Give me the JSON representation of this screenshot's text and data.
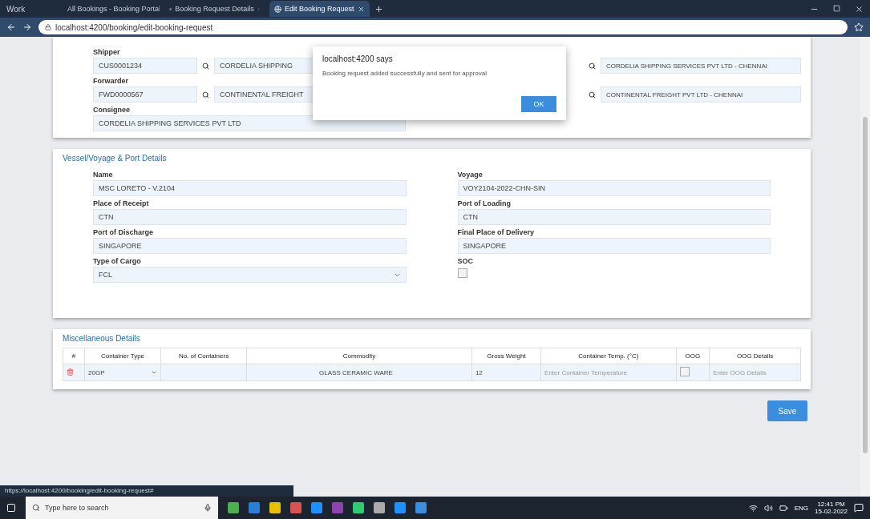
{
  "browser": {
    "profile": "Work",
    "tabs": [
      {
        "title": "All Bookings - Booking Portal",
        "selected": false
      },
      {
        "title": "Booking Request Details",
        "selected": false
      },
      {
        "title": "Edit Booking Request",
        "selected": true
      }
    ],
    "url": "localhost:4200/booking/edit-booking-request"
  },
  "parties": {
    "rows": [
      {
        "label": "Shipper",
        "code": "CUS0001234",
        "name": "CORDELIA SHIPPING",
        "name2": "CORDELIA SHIPPING SERVICES PVT LTD - CHENNAI"
      },
      {
        "label": "Forwarder",
        "code": "FWD0000567",
        "name": "CONTINENTAL FREIGHT",
        "name2": "CONTINENTAL FREIGHT PVT LTD - CHENNAI"
      }
    ],
    "consignee": {
      "label": "Consignee",
      "value": "CORDELIA SHIPPING SERVICES PVT LTD"
    }
  },
  "dialog": {
    "title": "localhost:4200 says",
    "message": "Booking request added successfully and sent for approval",
    "button": "OK"
  },
  "voyage": {
    "title": "Vessel/Voyage & Port Details",
    "fields": [
      {
        "label": "Name",
        "value": "MSC LORETO - V.2104",
        "kind": "text"
      },
      {
        "label": "Voyage",
        "value": "VOY2104-2022-CHN-SIN",
        "kind": "text"
      },
      {
        "label": "Place of Receipt",
        "value": "CTN",
        "kind": "text"
      },
      {
        "label": "Port of Loading",
        "value": "CTN",
        "kind": "text"
      },
      {
        "label": "Port of Discharge",
        "value": "SINGAPORE",
        "kind": "text"
      },
      {
        "label": "Final Place of Delivery",
        "value": "SINGAPORE",
        "kind": "text"
      },
      {
        "label": "Type of Cargo",
        "value": "FCL",
        "kind": "select"
      },
      {
        "label": "SOC",
        "checked": false,
        "kind": "checkbox"
      }
    ]
  },
  "misc": {
    "title": "Miscellaneous Details",
    "columns": [
      "#",
      "Container Type",
      "No. of Containers",
      "Commodity",
      "Gross Weight",
      "Container Temp. (°C)",
      "OOG",
      "OOG Details"
    ],
    "rows": [
      {
        "type": "20GP",
        "count": "",
        "commodity": "GLASS CERAMIC WARE",
        "weight": "12",
        "temp": "Enter Container Temperature",
        "oog": false,
        "oog_details": "Enter OOG Details"
      }
    ]
  },
  "save_button": "Save",
  "status_text": "https://localhost:4200/booking/edit-booking-request#",
  "taskbar": {
    "search": "Type here to search",
    "time": "12:41 PM",
    "date": "15-02-2022",
    "lang": "ENG"
  }
}
